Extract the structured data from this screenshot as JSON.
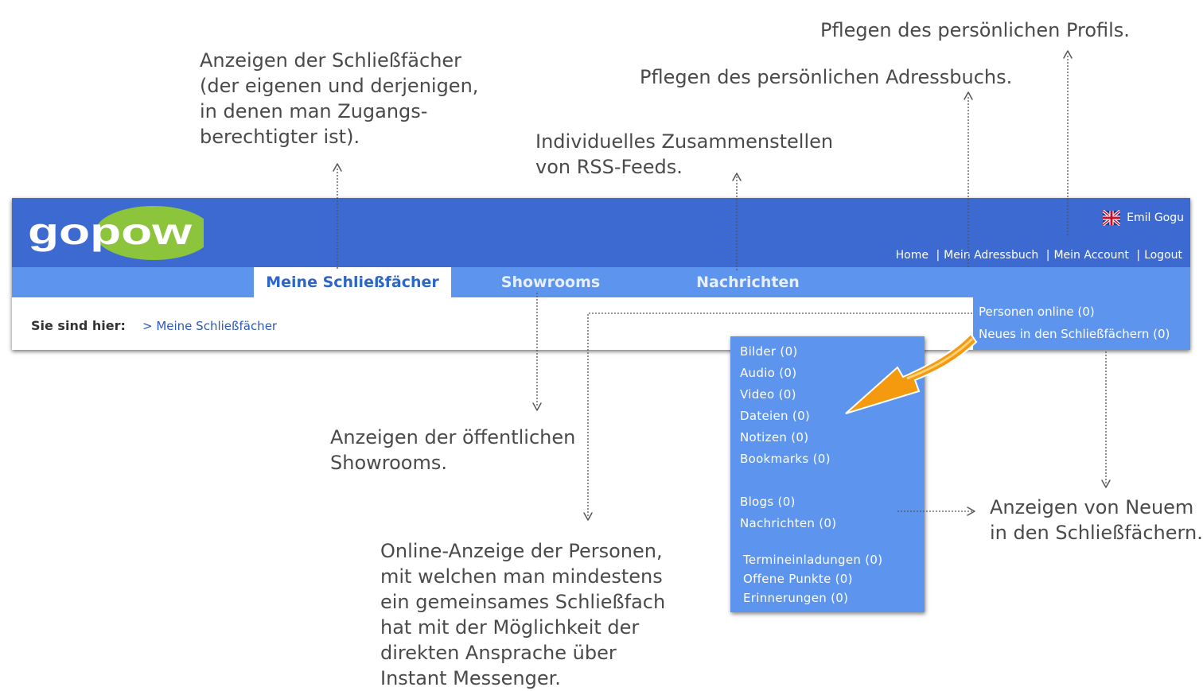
{
  "annotations": {
    "lockers": [
      "Anzeigen der Schließfächer",
      "(der eigenen und derjenigen,",
      "in denen man Zugangs-",
      "berechtigter ist)."
    ],
    "rss": [
      "Individuelles Zusammenstellen",
      "von RSS-Feeds."
    ],
    "addressbook": [
      "Pflegen des persönlichen Adressbuchs."
    ],
    "profile": [
      "Pflegen des persönlichen Profils."
    ],
    "showrooms": [
      "Anzeigen der öffentlichen",
      "Showrooms."
    ],
    "online": [
      "Online-Anzeige der Personen,",
      "mit welchen man mindestens",
      "ein gemeinsames Schließfach",
      "hat mit der Möglichkeit der",
      "direkten Ansprache über",
      "Instant Messenger."
    ],
    "news": [
      "Anzeigen von Neuem",
      "in den Schließfächern."
    ]
  },
  "header": {
    "logo_text": "gopow",
    "user_name": "Emil Gogu",
    "flag_icon": "uk-flag-icon",
    "links": [
      "Home",
      "Mein Adressbuch",
      "Mein Account",
      "Logout"
    ],
    "separator": "|"
  },
  "nav": {
    "tabs": [
      {
        "label": "Meine Schließfächer",
        "active": true
      },
      {
        "label": "Showrooms",
        "active": false
      },
      {
        "label": "Nachrichten",
        "active": false
      }
    ]
  },
  "breadcrumb": {
    "label": "Sie sind hier:",
    "path": "> Meine Schließfächer"
  },
  "side_panel": {
    "people_online": "Personen online (0)",
    "news_in_lockers": "Neues in den Schließfächern (0)"
  },
  "popup": {
    "items": [
      "Bilder (0)",
      "Audio (0)",
      "Video (0)",
      "Dateien (0)",
      "Notizen (0)",
      "Bookmarks (0)",
      "Blogs (0)",
      "Nachrichten (0)",
      "Termineinladungen (0)",
      "Offene Punkte (0)",
      "Erinnerungen (0)"
    ]
  },
  "colors": {
    "header_blue": "#3c6ad1",
    "nav_blue": "#5d95ee",
    "logo_green": "#8cc43c",
    "arrow_orange": "#f59a0f"
  }
}
